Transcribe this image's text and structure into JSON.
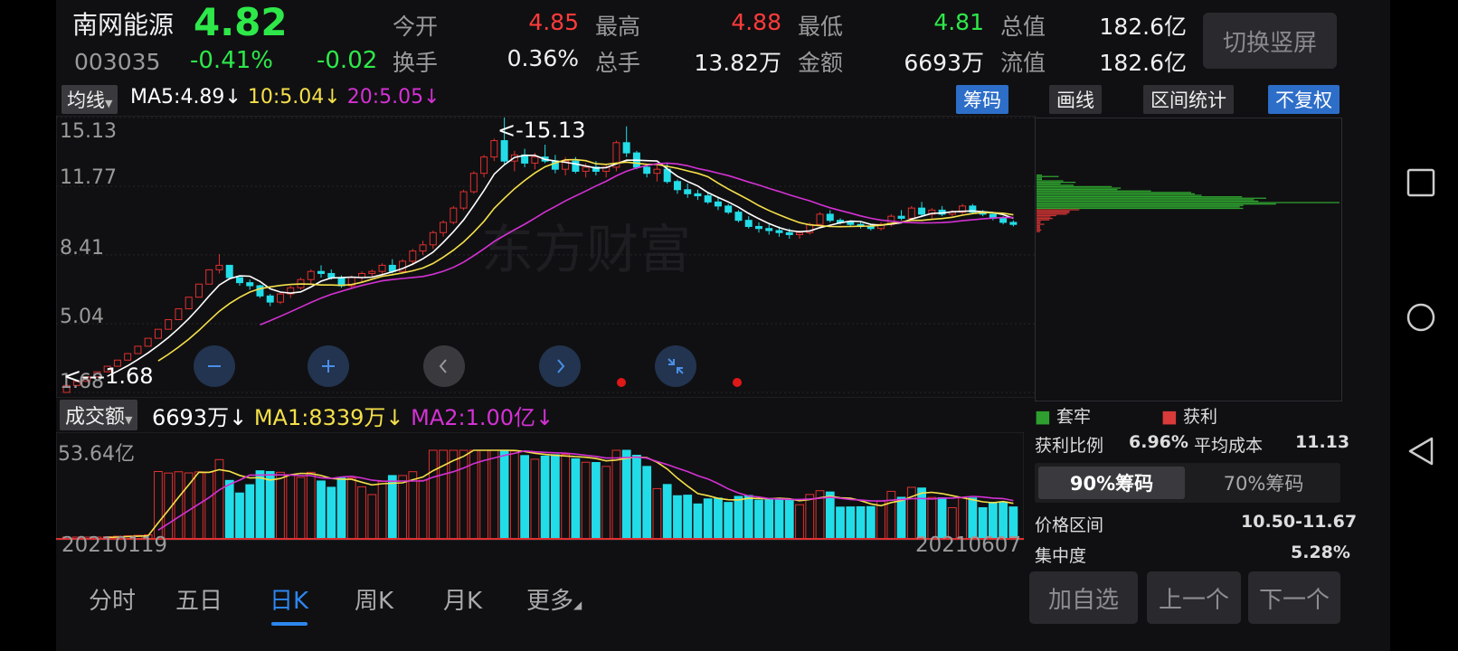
{
  "header": {
    "name": "南网能源",
    "price": "4.82",
    "code": "003035",
    "change_pct": "-0.41%",
    "change": "-0.02",
    "quotes": [
      {
        "label": "今开",
        "value": "4.85",
        "color": "#ff3b3b"
      },
      {
        "label": "最高",
        "value": "4.88",
        "color": "#ff3b3b"
      },
      {
        "label": "最低",
        "value": "4.81",
        "color": "#2ee84a"
      },
      {
        "label": "总值",
        "value": "182.6亿",
        "color": "#f0f0f0"
      },
      {
        "label": "换手",
        "value": "0.36%",
        "color": "#f0f0f0"
      },
      {
        "label": "总手",
        "value": "13.82万",
        "color": "#f0f0f0"
      },
      {
        "label": "金额",
        "value": "6693万",
        "color": "#f0f0f0"
      },
      {
        "label": "流值",
        "value": "182.6亿",
        "color": "#f0f0f0"
      }
    ],
    "portrait_button": "切换竖屏"
  },
  "ma_bar": {
    "selector": "均线",
    "ma5": "MA5:4.89",
    "ma10": "10:5.04",
    "ma20": "20:5.05",
    "arrow": "↓"
  },
  "tools": {
    "chips": "筹码",
    "draw": "画线",
    "interval": "区间统计",
    "adjust": "不复权"
  },
  "kchart": {
    "y_labels": [
      "15.13",
      "11.77",
      "8.41",
      "5.04",
      "1.68"
    ],
    "high_marker": "<-15.13",
    "low_marker": "<---1.68",
    "watermark": "东方财富"
  },
  "vol_bar": {
    "selector": "成交额",
    "value": "6693万",
    "ma1": "MA1:8339万",
    "ma2": "MA2:1.00亿",
    "arrow": "↓",
    "y_label": "53.64亿",
    "date_start": "20210119",
    "date_end": "20210607"
  },
  "chart_data": {
    "type": "candlestick",
    "y_ticks": [
      15.13,
      11.77,
      8.41,
      5.04,
      1.68
    ],
    "ylim": [
      1.68,
      15.13
    ],
    "x_start": "20210119",
    "x_end": "20210607",
    "ohlc": [
      [
        1.68,
        2.02,
        1.68,
        2.02
      ],
      [
        2.02,
        2.22,
        2.02,
        2.22
      ],
      [
        2.22,
        2.44,
        2.22,
        2.44
      ],
      [
        2.44,
        2.69,
        2.44,
        2.69
      ],
      [
        2.69,
        2.96,
        2.69,
        2.96
      ],
      [
        2.96,
        3.26,
        2.96,
        3.26
      ],
      [
        3.26,
        3.58,
        3.26,
        3.58
      ],
      [
        3.58,
        3.94,
        3.58,
        3.94
      ],
      [
        3.94,
        4.33,
        3.94,
        4.33
      ],
      [
        4.33,
        4.77,
        4.33,
        4.77
      ],
      [
        4.77,
        5.24,
        4.77,
        5.24
      ],
      [
        5.24,
        5.77,
        5.24,
        5.77
      ],
      [
        5.77,
        6.34,
        5.77,
        6.34
      ],
      [
        6.34,
        6.98,
        6.34,
        6.98
      ],
      [
        6.98,
        7.68,
        6.98,
        7.68
      ],
      [
        7.68,
        8.45,
        7.5,
        7.9
      ],
      [
        7.9,
        7.8,
        7.2,
        7.3
      ],
      [
        7.3,
        7.3,
        6.9,
        7.05
      ],
      [
        7.05,
        7.2,
        6.7,
        6.9
      ],
      [
        6.9,
        6.95,
        6.3,
        6.4
      ],
      [
        6.4,
        6.5,
        5.9,
        6.1
      ],
      [
        6.1,
        6.6,
        6.0,
        6.5
      ],
      [
        6.5,
        6.9,
        6.3,
        6.8
      ],
      [
        6.8,
        7.3,
        6.7,
        7.2
      ],
      [
        7.2,
        7.7,
        7.0,
        7.6
      ],
      [
        7.6,
        7.9,
        7.3,
        7.5
      ],
      [
        7.5,
        7.7,
        7.2,
        7.3
      ],
      [
        7.3,
        7.4,
        6.8,
        6.9
      ],
      [
        6.9,
        7.4,
        6.8,
        7.3
      ],
      [
        7.3,
        7.6,
        7.1,
        7.5
      ],
      [
        7.5,
        7.7,
        7.3,
        7.6
      ],
      [
        7.6,
        8.0,
        7.4,
        7.9
      ],
      [
        7.9,
        8.2,
        7.5,
        7.6
      ],
      [
        7.6,
        8.2,
        7.5,
        8.1
      ],
      [
        8.1,
        8.7,
        7.9,
        8.6
      ],
      [
        8.6,
        9.1,
        8.4,
        8.9
      ],
      [
        8.9,
        9.6,
        8.7,
        9.5
      ],
      [
        9.5,
        10.1,
        9.3,
        10.0
      ],
      [
        10.0,
        10.8,
        9.9,
        10.7
      ],
      [
        10.7,
        11.6,
        10.6,
        11.5
      ],
      [
        11.5,
        12.5,
        11.4,
        12.4
      ],
      [
        12.4,
        13.3,
        12.2,
        13.2
      ],
      [
        13.2,
        14.1,
        13.0,
        14.0
      ],
      [
        14.0,
        15.13,
        12.8,
        13.0
      ],
      [
        13.0,
        13.5,
        12.5,
        13.3
      ],
      [
        13.3,
        13.6,
        12.7,
        12.9
      ],
      [
        12.9,
        13.4,
        12.6,
        13.2
      ],
      [
        13.2,
        13.8,
        12.9,
        13.0
      ],
      [
        13.0,
        13.3,
        12.4,
        12.6
      ],
      [
        12.6,
        13.2,
        12.3,
        13.0
      ],
      [
        13.0,
        13.2,
        12.4,
        12.5
      ],
      [
        12.5,
        12.9,
        12.2,
        12.7
      ],
      [
        12.7,
        13.0,
        12.3,
        12.5
      ],
      [
        12.5,
        12.8,
        12.2,
        12.7
      ],
      [
        12.7,
        14.0,
        12.5,
        13.9
      ],
      [
        13.9,
        14.7,
        13.2,
        13.4
      ],
      [
        13.4,
        13.5,
        12.6,
        12.7
      ],
      [
        12.7,
        12.8,
        12.2,
        12.4
      ],
      [
        12.4,
        12.8,
        12.0,
        12.6
      ],
      [
        12.6,
        12.9,
        11.9,
        12.0
      ],
      [
        12.0,
        12.1,
        11.4,
        11.6
      ],
      [
        11.6,
        11.9,
        11.2,
        11.4
      ],
      [
        11.4,
        11.6,
        11.1,
        11.3
      ],
      [
        11.3,
        11.5,
        10.9,
        11.0
      ],
      [
        11.0,
        11.2,
        10.6,
        10.8
      ],
      [
        10.8,
        10.9,
        10.4,
        10.5
      ],
      [
        10.5,
        10.6,
        10.0,
        10.1
      ],
      [
        10.1,
        10.3,
        9.7,
        9.8
      ],
      [
        9.8,
        10.0,
        9.5,
        9.7
      ],
      [
        9.7,
        9.9,
        9.4,
        9.6
      ],
      [
        9.6,
        9.8,
        9.3,
        9.5
      ],
      [
        9.5,
        9.7,
        9.2,
        9.4
      ],
      [
        9.4,
        9.6,
        9.2,
        9.5
      ],
      [
        9.5,
        10.0,
        9.4,
        9.9
      ],
      [
        9.9,
        10.5,
        9.8,
        10.4
      ],
      [
        10.4,
        10.6,
        10.0,
        10.1
      ],
      [
        10.1,
        10.2,
        9.9,
        10.0
      ],
      [
        10.0,
        10.1,
        9.8,
        9.9
      ],
      [
        9.9,
        10.0,
        9.7,
        9.8
      ],
      [
        9.8,
        9.9,
        9.6,
        9.7
      ],
      [
        9.7,
        10.0,
        9.6,
        9.9
      ],
      [
        9.9,
        10.4,
        9.8,
        10.3
      ],
      [
        10.3,
        10.6,
        10.1,
        10.2
      ],
      [
        10.2,
        10.8,
        10.1,
        10.7
      ],
      [
        10.7,
        11.0,
        10.3,
        10.4
      ],
      [
        10.4,
        10.7,
        10.2,
        10.6
      ],
      [
        10.6,
        10.8,
        10.3,
        10.4
      ],
      [
        10.4,
        10.6,
        10.3,
        10.5
      ],
      [
        10.5,
        10.9,
        10.4,
        10.8
      ],
      [
        10.8,
        10.9,
        10.4,
        10.5
      ],
      [
        10.5,
        10.6,
        10.3,
        10.4
      ],
      [
        10.4,
        10.5,
        10.1,
        10.2
      ],
      [
        10.2,
        10.3,
        9.9,
        10.0
      ],
      [
        10.0,
        10.1,
        9.8,
        9.9
      ]
    ]
  }
}
